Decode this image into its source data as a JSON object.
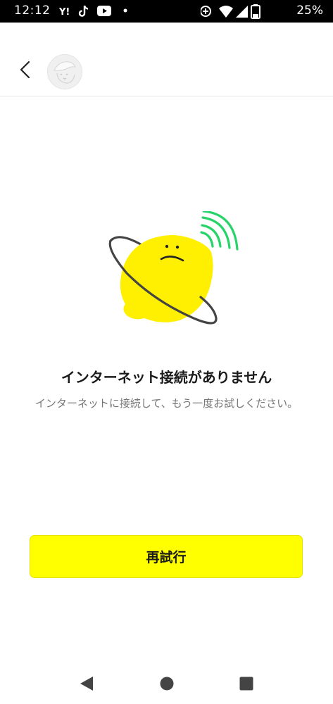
{
  "status_bar": {
    "time": "12:12",
    "left_icons": [
      "yahoo-news-icon",
      "tiktok-icon",
      "youtube-icon",
      "notification-dot-icon"
    ],
    "right_icons": [
      "data-saver-icon",
      "wifi-icon",
      "signal-icon",
      "battery-icon"
    ],
    "battery_percent": "25%"
  },
  "header": {
    "back_icon": "chevron-left-icon",
    "avatar_icon": "avatar-placeholder-icon"
  },
  "illustration": {
    "icon": "sad-planet-no-wifi-icon",
    "colors": {
      "planet": "#ffef00",
      "ring": "#444444",
      "signal": "#28d46a"
    }
  },
  "error": {
    "title": "インターネット接続がありません",
    "message": "インターネットに接続して、もう一度お試しください。"
  },
  "retry_button": {
    "label": "再試行",
    "color": "#ffff00"
  },
  "nav_bar": {
    "back_icon": "nav-back-icon",
    "home_icon": "nav-home-icon",
    "recents_icon": "nav-recents-icon"
  }
}
